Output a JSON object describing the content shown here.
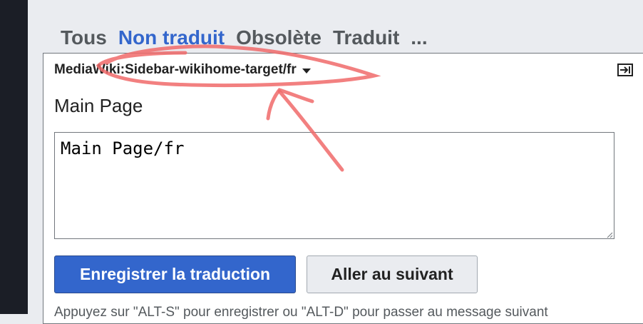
{
  "tabs": [
    {
      "label": "Tous"
    },
    {
      "label": "Non traduit"
    },
    {
      "label": "Obsolète"
    },
    {
      "label": "Traduit"
    },
    {
      "label": "..."
    }
  ],
  "active_tab": "Non traduit",
  "message": {
    "key": "MediaWiki:Sidebar-wikihome-target/fr",
    "source_text": "Main Page",
    "translation_value": "Main Page/fr"
  },
  "buttons": {
    "save_label": "Enregistrer la traduction",
    "next_label": "Aller au suivant"
  },
  "hint": "Appuyez sur \"ALT-S\" pour enregistrer ou \"ALT-D\" pour passer au message suivant",
  "colors": {
    "accent": "#3366cc",
    "annotation": "#f06a6a"
  },
  "icons": {
    "dropdown": "chevron-down-icon",
    "expand": "expand-icon"
  }
}
